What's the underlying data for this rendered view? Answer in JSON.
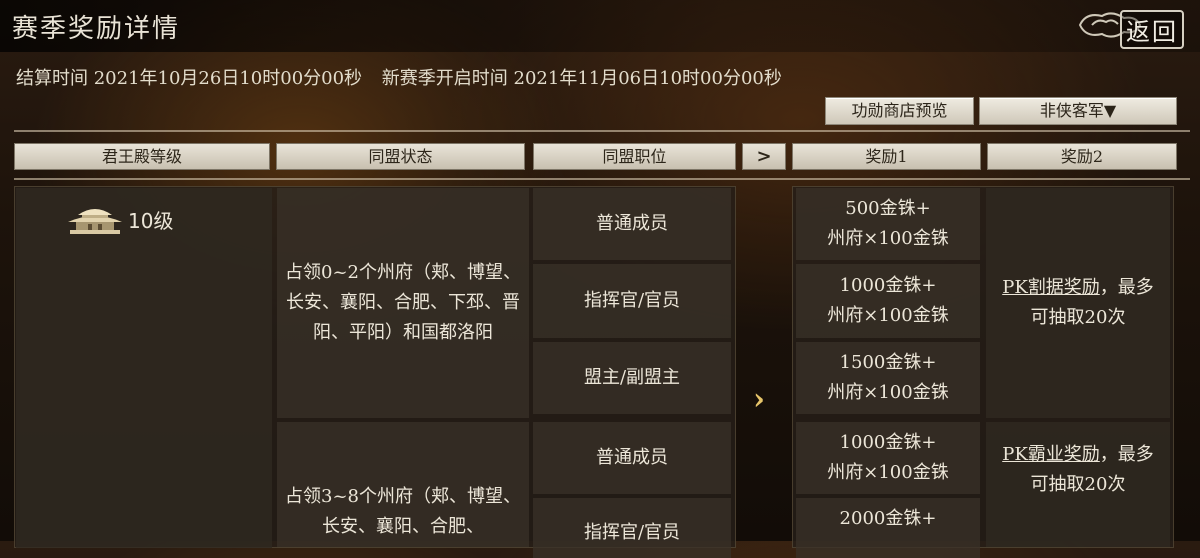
{
  "header": {
    "title": "赛季奖励详情",
    "back_label": "返回"
  },
  "timeline": {
    "settle_label": "结算时间 2021年10月26日10时00分00秒",
    "next_label": "新赛季开启时间 2021年11月06日10时00分00秒"
  },
  "buttons": {
    "shop_preview": "功勋商店预览",
    "filter_selected": "非侠客军▼"
  },
  "columns": {
    "palace_level": "君王殿等级",
    "alliance_state": "同盟状态",
    "alliance_role": "同盟职位",
    "next_arrow": ">",
    "reward1": "奖励1",
    "reward2": "奖励2"
  },
  "level": {
    "text": "10级"
  },
  "groups": [
    {
      "state": "占领0~2个州府（郏、博望、长安、襄阳、合肥、下邳、晋阳、平阳）和国都洛阳",
      "roles": [
        {
          "role": "普通成员",
          "r1_line1": "500金铢+",
          "r1_line2": "州府×100金铢"
        },
        {
          "role": "指挥官/官员",
          "r1_line1": "1000金铢+",
          "r1_line2": "州府×100金铢"
        },
        {
          "role": "盟主/副盟主",
          "r1_line1": "1500金铢+",
          "r1_line2": "州府×100金铢"
        }
      ],
      "reward2_link": "PK割据奖励",
      "reward2_rest": "，最多可抽取20次"
    },
    {
      "state": "占领3~8个州府（郏、博望、长安、襄阳、合肥、",
      "roles": [
        {
          "role": "普通成员",
          "r1_line1": "1000金铢+",
          "r1_line2": "州府×100金铢"
        },
        {
          "role": "指挥官/官员",
          "r1_line1": "2000金铢+",
          "r1_line2": ""
        }
      ],
      "reward2_link": "PK霸业奖励",
      "reward2_rest": "，最多可抽取20次"
    }
  ],
  "mid_arrow": "›"
}
